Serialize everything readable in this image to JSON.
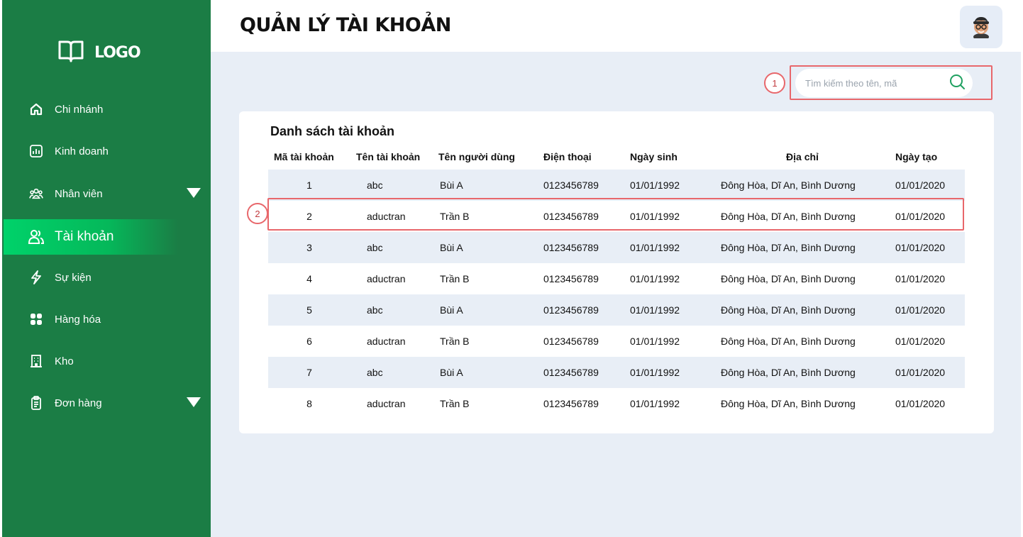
{
  "sidebar": {
    "logo_text": "LOGO",
    "items": [
      {
        "label": "Chi nhánh",
        "icon": "home-icon"
      },
      {
        "label": "Kinh doanh",
        "icon": "chart-icon"
      },
      {
        "label": "Nhân viên",
        "icon": "users-icon",
        "has_caret": true
      },
      {
        "label": "Tài khoản",
        "icon": "account-icon",
        "active": true
      },
      {
        "label": "Sự kiện",
        "icon": "lightning-icon"
      },
      {
        "label": "Hàng hóa",
        "icon": "grid-icon"
      },
      {
        "label": "Kho",
        "icon": "building-icon"
      },
      {
        "label": "Đơn hàng",
        "icon": "clipboard-icon",
        "has_caret": true
      }
    ]
  },
  "header": {
    "title": "QUẢN LÝ TÀI KHOẢN"
  },
  "search": {
    "placeholder": "Tìm kiếm theo tên, mã",
    "callout": "1"
  },
  "table": {
    "title": "Danh sách tài khoản",
    "highlight_callout": "2",
    "columns": [
      "Mã tài khoản",
      "Tên tài khoản",
      "Tên người dùng",
      "Điện thoại",
      "Ngày sinh",
      "Địa chỉ",
      "Ngày tạo"
    ],
    "rows": [
      [
        "1",
        "abc",
        "Bùi A",
        "0123456789",
        "01/01/1992",
        "Đông Hòa, Dĩ An, Bình Dương",
        "01/01/2020"
      ],
      [
        "2",
        "aductran",
        "Trần B",
        "0123456789",
        "01/01/1992",
        "Đông Hòa, Dĩ An, Bình Dương",
        "01/01/2020"
      ],
      [
        "3",
        "abc",
        "Bùi A",
        "0123456789",
        "01/01/1992",
        "Đông Hòa, Dĩ An, Bình Dương",
        "01/01/2020"
      ],
      [
        "4",
        "aductran",
        "Trần B",
        "0123456789",
        "01/01/1992",
        "Đông Hòa, Dĩ An, Bình Dương",
        "01/01/2020"
      ],
      [
        "5",
        "abc",
        "Bùi A",
        "0123456789",
        "01/01/1992",
        "Đông Hòa, Dĩ An, Bình Dương",
        "01/01/2020"
      ],
      [
        "6",
        "aductran",
        "Trần B",
        "0123456789",
        "01/01/1992",
        "Đông Hòa, Dĩ An, Bình Dương",
        "01/01/2020"
      ],
      [
        "7",
        "abc",
        "Bùi A",
        "0123456789",
        "01/01/1992",
        "Đông Hòa, Dĩ An, Bình Dương",
        "01/01/2020"
      ],
      [
        "8",
        "aductran",
        "Trần B",
        "0123456789",
        "01/01/1992",
        "Đông Hòa, Dĩ An, Bình Dương",
        "01/01/2020"
      ]
    ]
  },
  "colors": {
    "sidebar_bg": "#1b7d45",
    "active_gradient_start": "#00d26a",
    "main_bg": "#e8eef6",
    "callout": "#e8676b",
    "search_icon": "#1fa060"
  }
}
